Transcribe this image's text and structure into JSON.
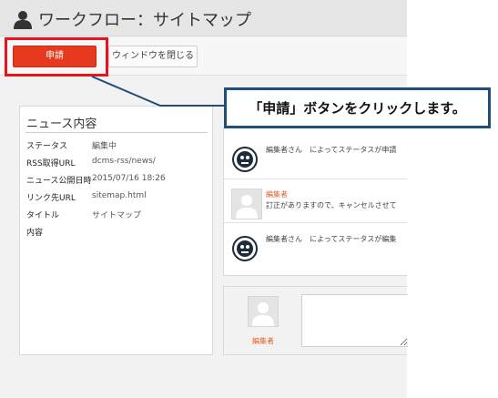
{
  "window": {
    "title": "ワークフロー：サイトマップ",
    "icon": "user-icon"
  },
  "toolbar": {
    "apply_label": "申請",
    "close_window_label": "ウィンドウを閉じる"
  },
  "news": {
    "panel_title": "ニュース内容",
    "fields": [
      {
        "key": "ステータス",
        "value": "編集中"
      },
      {
        "key": "RSS取得URL",
        "value": "dcms-rss/news/"
      },
      {
        "key": "ニュース公開日時",
        "value": "2015/07/16 18:26"
      },
      {
        "key": "リンク先URL",
        "value": "sitemap.html"
      },
      {
        "key": "タイトル",
        "value": "サイトマップ"
      },
      {
        "key": "内容",
        "value": ""
      }
    ]
  },
  "history": [
    {
      "type": "system",
      "avatar": "robot-icon",
      "text": "編集者さん　によってステータスが申請"
    },
    {
      "type": "user",
      "avatar": "user-avatar-icon",
      "name": "編集者",
      "text": "訂正がありますので、キャンセルさせて"
    },
    {
      "type": "system",
      "avatar": "robot-icon",
      "text": "編集者さん　によってステータスが編集"
    }
  ],
  "composer": {
    "name": "編集者",
    "input_value": ""
  },
  "callout": {
    "text": "「申請」ボタンをクリックします。"
  },
  "colors": {
    "apply_button": "#e53a1e",
    "highlight": "#e8141c",
    "callout_border": "#1f4e79",
    "editor_name": "#e0602a"
  }
}
